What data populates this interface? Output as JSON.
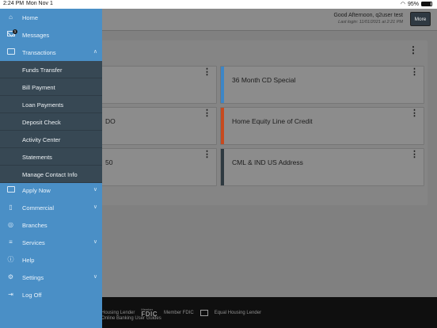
{
  "status_bar": {
    "time": "2:24 PM",
    "date": "Mon Nov 1",
    "battery": "95%"
  },
  "header": {
    "greeting": "Good Afternoon, q2user test",
    "last_login": "Last login: 11/01/2021 at 2:21 PM",
    "more_label": "More"
  },
  "accounts": [
    {
      "name": "",
      "color": "#2f7fc0"
    },
    {
      "name": "36 Month CD Special",
      "color": "#3d86c6"
    },
    {
      "name": "DO",
      "color": "#c74a1f"
    },
    {
      "name": "Home Equity Line of Credit",
      "color": "#c74a1f"
    },
    {
      "name": "50",
      "color": "#2e3940"
    },
    {
      "name": "CML & IND US Address",
      "color": "#2e3940"
    }
  ],
  "footer": {
    "housing_left": "Housing Lender",
    "fdic_small": "Member",
    "fdic": "FDIC",
    "member_fdic": "Member FDIC",
    "equal_housing": "Equal Housing Lender",
    "guides": "Online Banking User Guides"
  },
  "nav": {
    "home": "Home",
    "messages": "Messages",
    "messages_badge": "1",
    "transactions": "Transactions",
    "transactions_sub": [
      "Funds Transfer",
      "Bill Payment",
      "Loan Payments",
      "Deposit Check",
      "Activity Center",
      "Statements",
      "Manage Contact Info"
    ],
    "apply_now": "Apply Now",
    "commercial": "Commercial",
    "branches": "Branches",
    "services": "Services",
    "help": "Help",
    "settings": "Settings",
    "log_off": "Log Off"
  },
  "colors": {
    "drawer": "#4a8fc6",
    "submenu": "#374854",
    "more_button": "#2f3942"
  },
  "icons": {
    "home": "home-icon",
    "messages": "envelope-icon",
    "transactions": "card-icon",
    "apply_now": "card-icon",
    "commercial": "building-icon",
    "branches": "map-pin-icon",
    "services": "list-icon",
    "help": "help-icon",
    "settings": "gear-icon",
    "log_off": "logout-icon"
  }
}
